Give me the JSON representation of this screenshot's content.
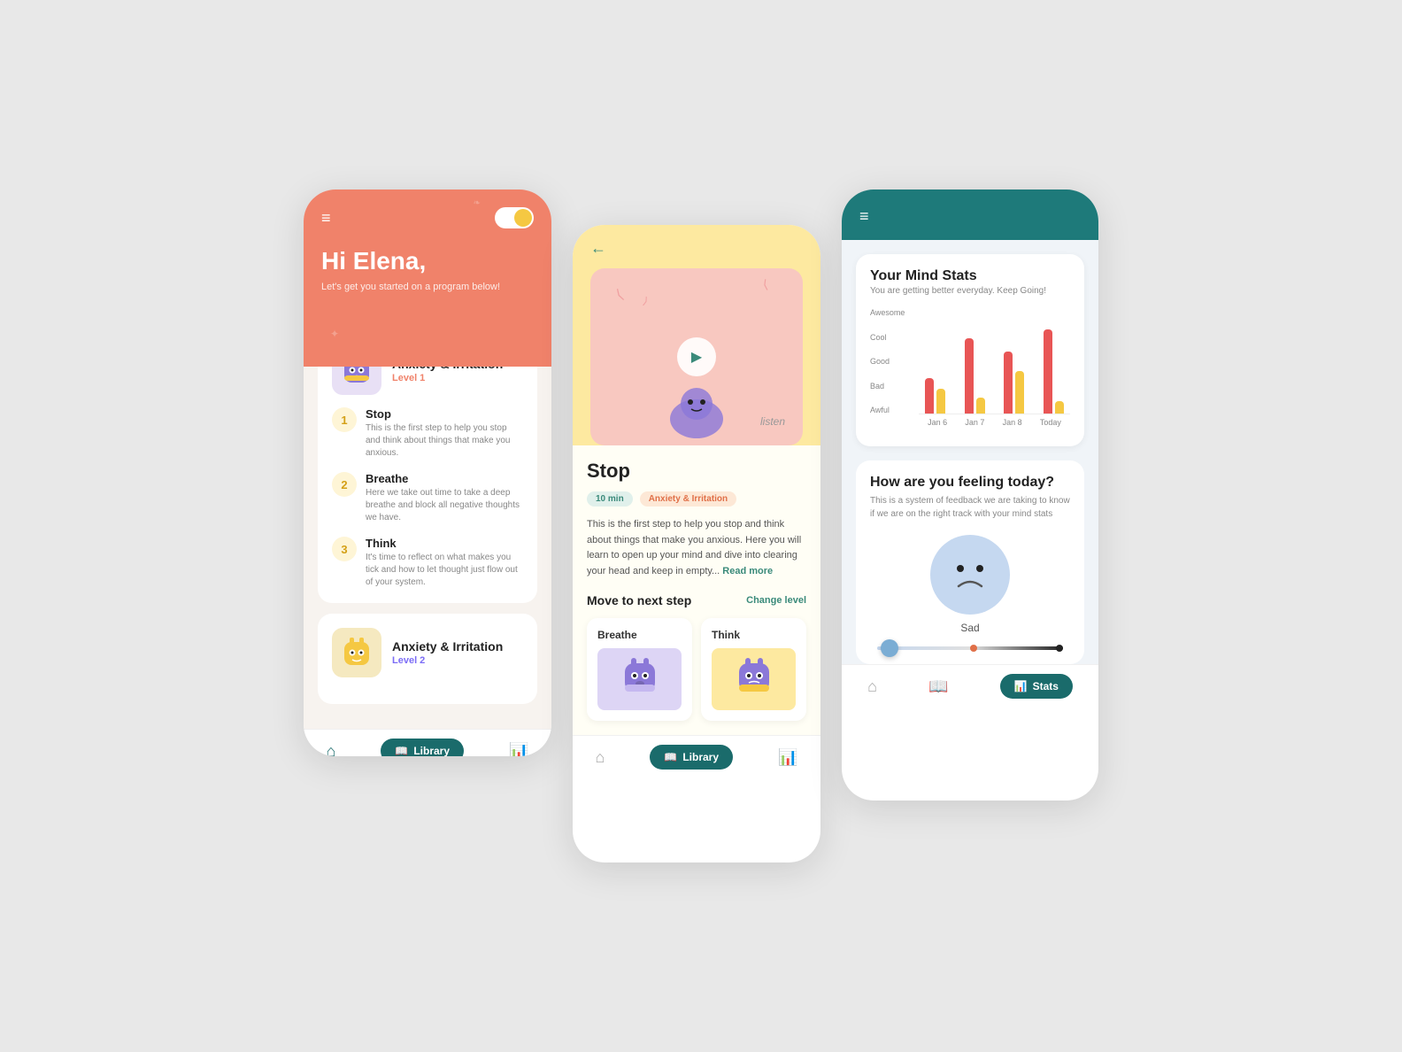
{
  "screen1": {
    "header_title": "Hi Elena,",
    "header_subtitle": "Let's get you started on a program below!",
    "toggle_label": "toggle",
    "card1": {
      "title": "Anxiety & Irritation",
      "level": "Level 1",
      "steps": [
        {
          "num": "1",
          "title": "Stop",
          "desc": "This is the first step to help you stop and think about things that make you anxious."
        },
        {
          "num": "2",
          "title": "Breathe",
          "desc": "Here we take out time to take a deep breathe and block all negative thoughts we have."
        },
        {
          "num": "3",
          "title": "Think",
          "desc": "It's time to reflect on what makes you tick and how to let thought just flow out of your system."
        }
      ]
    },
    "card2": {
      "title": "Anxiety & Irritation",
      "level": "Level 2"
    },
    "nav": {
      "home_label": "Home",
      "library_label": "Library",
      "stats_label": "Stats"
    }
  },
  "screen2": {
    "back_label": "←",
    "stop_title": "Stop",
    "tag_time": "10 min",
    "tag_category": "Anxiety & Irritation",
    "description": "This is the first step to help you stop and think about things that make you anxious. Here you will learn to open up your mind and dive into clearing your head and keep in empty...",
    "read_more": "Read more",
    "next_section_title": "Move to next step",
    "change_level": "Change level",
    "next_cards": [
      {
        "label": "Breathe",
        "color": "purple"
      },
      {
        "label": "Think",
        "color": "yellow"
      }
    ],
    "listen_text": "listen",
    "nav": {
      "library_label": "Library"
    }
  },
  "screen3": {
    "stats_title": "Your Mind Stats",
    "stats_subtitle": "You are getting better everyday. Keep Going!",
    "chart": {
      "y_labels": [
        "Awesome",
        "Cool",
        "Good",
        "Bad",
        "Awful"
      ],
      "x_labels": [
        "Jan 6",
        "Jan 7",
        "Jan 8",
        "Today"
      ],
      "bars": [
        {
          "red": 40,
          "yellow": 30
        },
        {
          "red": 85,
          "yellow": 20
        },
        {
          "red": 70,
          "yellow": 50
        },
        {
          "red": 95,
          "yellow": 15
        }
      ]
    },
    "feeling_title": "How are you feeling today?",
    "feeling_desc": "This is a system of feedback we are taking to know if we are on the right track with your mind stats",
    "feeling_current": "Sad",
    "nav": {
      "stats_label": "Stats"
    }
  }
}
